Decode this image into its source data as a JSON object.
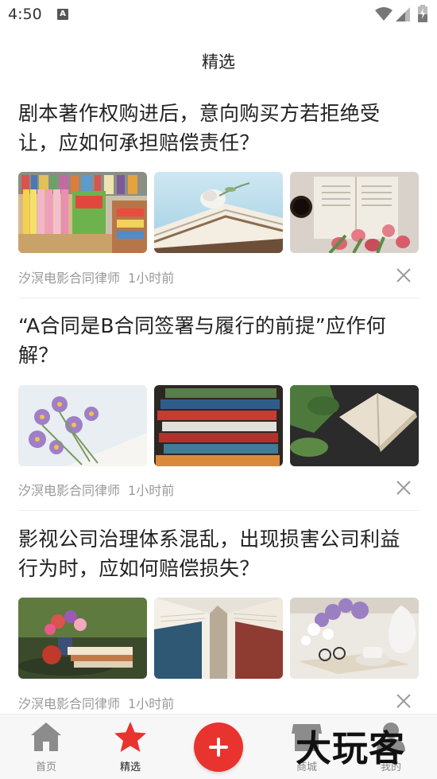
{
  "status_bar": {
    "time": "4:50",
    "notification_icon": "A"
  },
  "page_title": "精选",
  "articles": [
    {
      "title": "剧本著作权购进后，意向购买方若拒绝受让，应如何承担赔偿责任？",
      "author": "汐溟电影合同律师",
      "time": "1小时前",
      "images": [
        "bookstore-shelf-image",
        "rose-on-book-image",
        "open-book-tulips-image"
      ]
    },
    {
      "title": "“A合同是B合同签署与履行的前提”应作何解？",
      "author": "汐溟电影合同律师",
      "time": "1小时前",
      "images": [
        "purple-flowers-image",
        "book-stack-image",
        "open-book-leaves-image"
      ]
    },
    {
      "title": "影视公司治理体系混乱，出现损害公司利益行为时，应如何赔偿损失？",
      "author": "汐溟电影合同律师",
      "time": "1小时前",
      "images": [
        "flowers-apple-books-image",
        "open-book-pages-image",
        "lilac-teacup-glasses-image"
      ]
    }
  ],
  "tabbar": {
    "home_label": "首页",
    "featured_label": "精选",
    "mall_label": "商城",
    "mine_label": "我的",
    "active_color": "#e8332f"
  },
  "watermark": "大玩客"
}
